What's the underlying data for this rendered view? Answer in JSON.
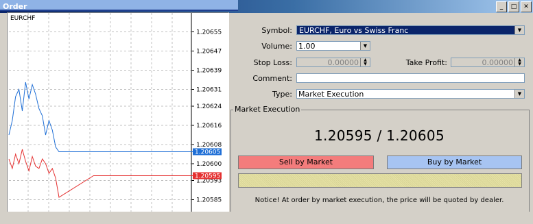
{
  "window": {
    "title": "Order",
    "controls": [
      "_",
      "□",
      "✕"
    ]
  },
  "chart": {
    "symbol_label": "EURCHF",
    "ticks": [
      "1.20655",
      "1.20647",
      "1.20639",
      "1.20631",
      "1.20624",
      "1.20616",
      "1.20608",
      "1.20600",
      "1.20593",
      "1.20585"
    ],
    "ask_label": "1.20605",
    "bid_label": "1.20595",
    "colors": {
      "ask": "#1f6fd6",
      "bid": "#e53030"
    }
  },
  "chart_data": {
    "type": "line",
    "title": "EURCHF",
    "ylim": [
      1.2058,
      1.2066
    ],
    "series": [
      {
        "values": [
          1.20612,
          1.20618,
          1.20628,
          1.20631,
          1.20622,
          1.20634,
          1.20627,
          1.20633,
          1.20629,
          1.20623,
          1.2062,
          1.20612,
          1.20618,
          1.20614,
          1.20607,
          1.20605,
          1.20605,
          1.20605,
          1.20605,
          1.20605
        ]
      },
      {
        "values": [
          1.20602,
          1.20598,
          1.20604,
          1.206,
          1.20606,
          1.20601,
          1.20597,
          1.20603,
          1.20599,
          1.20598,
          1.20602,
          1.206,
          1.20596,
          1.20598,
          1.20594,
          1.20586,
          1.20595,
          1.20595,
          1.20595,
          1.20595
        ]
      }
    ]
  },
  "form": {
    "symbol_label": "Symbol:",
    "symbol_value": "EURCHF, Euro vs Swiss Franc",
    "volume_label": "Volume:",
    "volume_value": "1.00",
    "stoploss_label": "Stop Loss:",
    "stoploss_value": "0.00000",
    "takeprofit_label": "Take Profit:",
    "takeprofit_value": "0.00000",
    "comment_label": "Comment:",
    "comment_value": "",
    "type_label": "Type:",
    "type_value": "Market Execution"
  },
  "execution": {
    "group_title": "Market Execution",
    "prices": "1.20595 / 1.20605",
    "sell_label": "Sell by Market",
    "buy_label": "Buy by Market",
    "notice": "Notice! At order by market execution, the price will be quoted by dealer."
  }
}
